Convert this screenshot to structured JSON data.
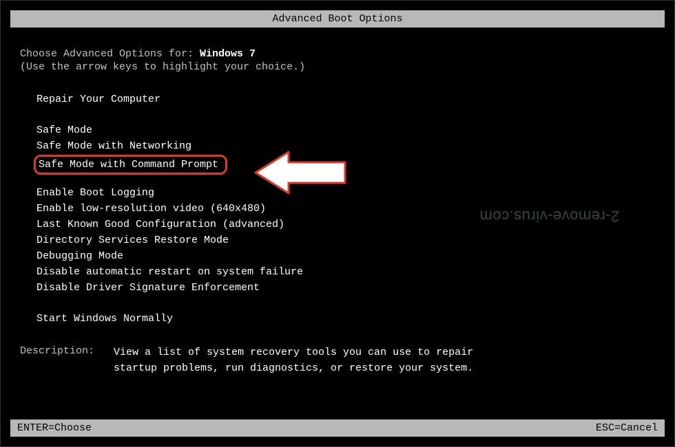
{
  "title": "Advanced Boot Options",
  "intro": {
    "prefix": "Choose Advanced Options for: ",
    "os_name": "Windows 7",
    "hint": "(Use the arrow keys to highlight your choice.)"
  },
  "menu": {
    "group1": [
      "Repair Your Computer"
    ],
    "group2": [
      "Safe Mode",
      "Safe Mode with Networking",
      "Safe Mode with Command Prompt"
    ],
    "group3": [
      "Enable Boot Logging",
      "Enable low-resolution video (640x480)",
      "Last Known Good Configuration (advanced)",
      "Directory Services Restore Mode",
      "Debugging Mode",
      "Disable automatic restart on system failure",
      "Disable Driver Signature Enforcement"
    ],
    "group4": [
      "Start Windows Normally"
    ],
    "highlighted_index": 2,
    "highlighted_group": "group2"
  },
  "description": {
    "label": "Description:",
    "text": "View a list of system recovery tools you can use to repair startup problems, run diagnostics, or restore your system."
  },
  "footer": {
    "left": "ENTER=Choose",
    "right": "ESC=Cancel"
  },
  "watermark": "2-remove-virus.com",
  "annotation": {
    "highlight_color": "#d93a2b",
    "arrow_color": "#ffffff",
    "arrow_border": "#d93a2b"
  }
}
